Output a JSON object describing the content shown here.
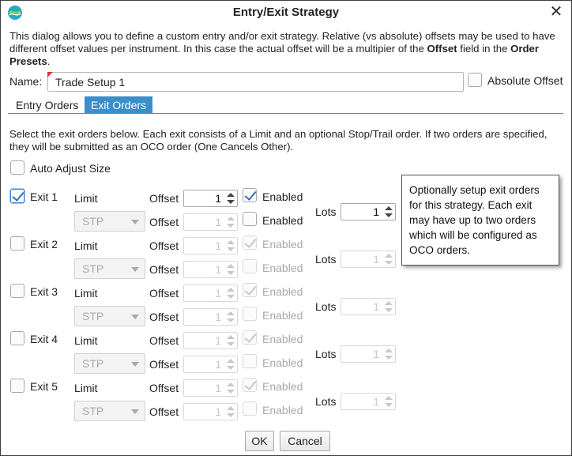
{
  "window": {
    "title": "Entry/Exit Strategy",
    "close_glyph": "✕"
  },
  "description": {
    "part1": "This dialog allows you to define a custom entry and/or exit strategy.  Relative (vs absolute) offsets may be used to have different offset values per instrument.  In this case the actual offset will be a multipier of the ",
    "bold1": "Offset",
    "part2": " field in the ",
    "bold2": "Order Presets",
    "part3": "."
  },
  "name_field": {
    "label": "Name:",
    "value": "Trade Setup 1"
  },
  "absolute_offset": {
    "label": "Absolute Offset",
    "checked": false
  },
  "tabs": [
    {
      "label": "Entry Orders",
      "active": false
    },
    {
      "label": "Exit Orders",
      "active": true
    }
  ],
  "exit_tab": {
    "instructions": "Select the exit orders below.  Each exit consists of a Limit and an optional Stop/Trail order.  If two orders are specified, they will be submitted as an OCO order (One Cancels Other).",
    "auto_adjust_label": "Auto Adjust Size",
    "limit_label": "Limit",
    "offset_label": "Offset",
    "enabled_label": "Enabled",
    "lots_label": "Lots",
    "stop_type_value": "STP"
  },
  "exits": [
    {
      "label": "Exit 1",
      "checked": true,
      "limit_offset": "1",
      "limit_enabled": true,
      "stop_offset": "1",
      "stop_enabled": false,
      "lots": "1"
    },
    {
      "label": "Exit 2",
      "checked": false,
      "limit_offset": "1",
      "limit_enabled": true,
      "stop_offset": "1",
      "stop_enabled": false,
      "lots": "1"
    },
    {
      "label": "Exit 3",
      "checked": false,
      "limit_offset": "1",
      "limit_enabled": true,
      "stop_offset": "1",
      "stop_enabled": false,
      "lots": "1"
    },
    {
      "label": "Exit 4",
      "checked": false,
      "limit_offset": "1",
      "limit_enabled": true,
      "stop_offset": "1",
      "stop_enabled": false,
      "lots": "1"
    },
    {
      "label": "Exit 5",
      "checked": false,
      "limit_offset": "1",
      "limit_enabled": true,
      "stop_offset": "1",
      "stop_enabled": false,
      "lots": "1"
    }
  ],
  "tooltip": {
    "text": "Optionally setup exit orders for this strategy. Each exit may have up to two orders which will be configured as OCO orders."
  },
  "buttons": {
    "ok": "OK",
    "cancel": "Cancel"
  },
  "colors": {
    "accent_tab": "#3a8ec9",
    "check_mark": "#3a6db3",
    "required_flag": "#e0303a"
  }
}
